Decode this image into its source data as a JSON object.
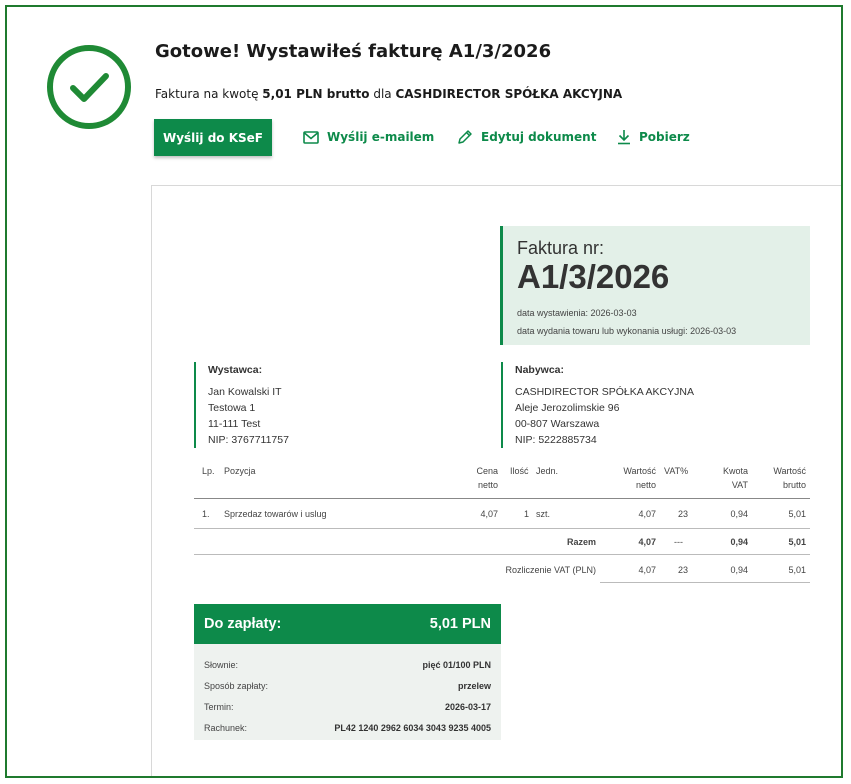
{
  "header": {
    "title": "Gotowe! Wystawiłeś fakturę A1/3/2026",
    "subtitle_prefix": "Faktura na kwotę ",
    "subtitle_amount": "5,01 PLN brutto",
    "subtitle_mid": " dla ",
    "subtitle_buyer": "CASHDIRECTOR SPÓŁKA AKCYJNA"
  },
  "actions": {
    "send_ksef": "Wyślij do KSeF",
    "send_email": "Wyślij e-mailem",
    "edit": "Edytuj dokument",
    "download": "Pobierz"
  },
  "invoice": {
    "label": "Faktura nr:",
    "number": "A1/3/2026",
    "issue_date": "data wystawienia: 2026-03-03",
    "delivery_date": "data wydania towaru lub wykonania usługi: 2026-03-03"
  },
  "seller": {
    "title": "Wystawca:",
    "name": "Jan Kowalski IT",
    "street": "Testowa 1",
    "city": "11-111 Test",
    "nip": "NIP: 3767711757"
  },
  "buyer": {
    "title": "Nabywca:",
    "name": "CASHDIRECTOR SPÓŁKA AKCYJNA",
    "street": "Aleje Jerozolimskie 96",
    "city": "00-807 Warszawa",
    "nip": "NIP: 5222885734"
  },
  "table": {
    "headers": {
      "lp": "Lp.",
      "item": "Pozycja",
      "net_price_1": "Cena",
      "net_price_2": "netto",
      "qty": "Ilość",
      "unit": "Jedn.",
      "net_value_1": "Wartość",
      "net_value_2": "netto",
      "vat_rate": "VAT%",
      "vat_amount_1": "Kwota",
      "vat_amount_2": "VAT",
      "gross_1": "Wartość",
      "gross_2": "brutto"
    },
    "rows": [
      {
        "lp": "1.",
        "item": "Sprzedaz towarów i uslug",
        "net_price": "4,07",
        "qty": "1",
        "unit": "szt.",
        "net_value": "4,07",
        "vat_rate": "23",
        "vat_amount": "0,94",
        "gross": "5,01"
      }
    ],
    "total": {
      "label": "Razem",
      "net_value": "4,07",
      "vat_rate": "---",
      "vat_amount": "0,94",
      "gross": "5,01"
    },
    "vat_summary": {
      "label": "Rozliczenie VAT (PLN)",
      "net_value": "4,07",
      "vat_rate": "23",
      "vat_amount": "0,94",
      "gross": "5,01"
    }
  },
  "payment": {
    "title": "Do zapłaty:",
    "amount": "5,01 PLN",
    "words_label": "Słownie:",
    "words": "pięć 01/100 PLN",
    "method_label": "Sposób zapłaty:",
    "method": "przelew",
    "due_label": "Termin:",
    "due": "2026-03-17",
    "account_label": "Rachunek:",
    "account": "PL42 1240 2962 6034 3043 9235 4005"
  },
  "colors": {
    "accent": "#0d8a4a",
    "check": "#1f8a35",
    "frame": "#1f7a2e",
    "invoice_box": "#e3f0e8"
  },
  "icons": [
    "check-icon",
    "envelope-icon",
    "pencil-icon",
    "download-icon"
  ]
}
